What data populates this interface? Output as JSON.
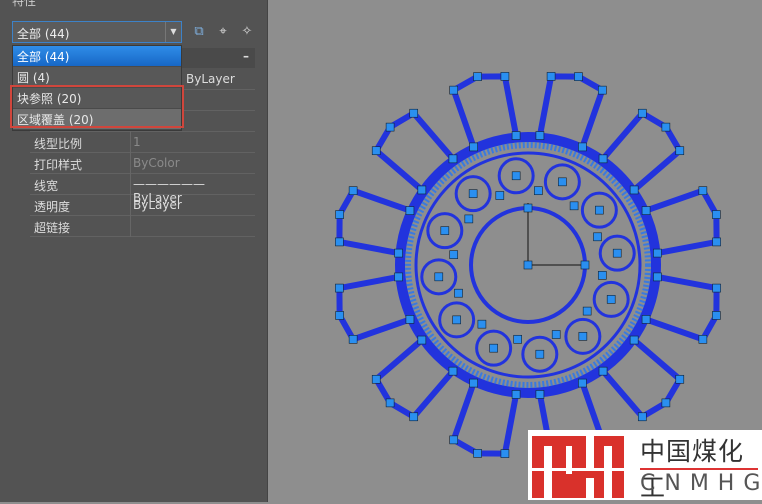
{
  "panel": {
    "title": "特性",
    "selector": "全部 (44)"
  },
  "dropdown": [
    "全部 (44)",
    "圆 (4)",
    "块参照 (20)",
    "区域覆盖 (20)"
  ],
  "hidden_value": "ByLayer",
  "properties": [
    {
      "k": "线型比例",
      "v": "1",
      "grey": true
    },
    {
      "k": "打印样式",
      "v": "ByColor",
      "grey": true
    },
    {
      "k": "线宽",
      "v": "——————  ByLayer",
      "grey": false
    },
    {
      "k": "透明度",
      "v": "ByLayer",
      "grey": false
    },
    {
      "k": "超链接",
      "v": "",
      "grey": false
    }
  ],
  "logo": {
    "cn": "中国煤化工",
    "en": "CNMHG",
    "mark": "MH"
  },
  "colors": {
    "selection": "#1767c6",
    "highlight": "#d0463c",
    "geometry": "#2233dd",
    "grip": "#2a8ff0"
  }
}
